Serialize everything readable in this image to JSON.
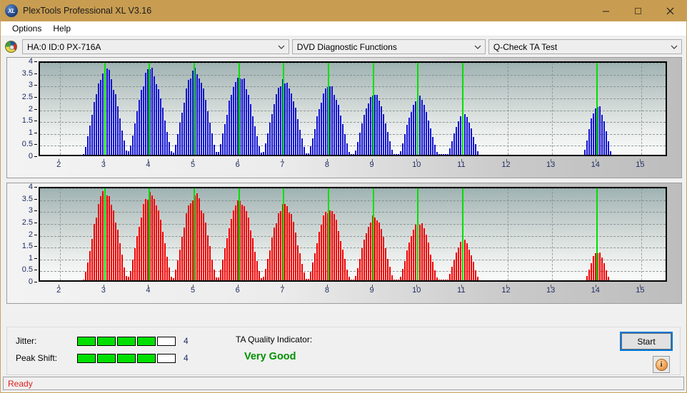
{
  "window": {
    "title": "PlexTools Professional XL V3.16",
    "app_icon": "xl-disc-icon",
    "minimize_label": "Minimize",
    "maximize_label": "Maximize",
    "close_label": "Close"
  },
  "menubar": {
    "items": [
      {
        "label": "Options"
      },
      {
        "label": "Help"
      }
    ]
  },
  "selectors": {
    "drive_icon": "optical-disc-icon",
    "drive": "HA:0 ID:0  PX-716A",
    "function": "DVD Diagnostic Functions",
    "test": "Q-Check TA Test"
  },
  "results": {
    "jitter_label": "Jitter:",
    "jitter_value": "4",
    "jitter_segments_on": 4,
    "jitter_segments_total": 5,
    "peak_shift_label": "Peak Shift:",
    "peak_shift_value": "4",
    "peak_shift_segments_on": 4,
    "peak_shift_segments_total": 5,
    "ta_title": "TA Quality Indicator:",
    "ta_value": "Very Good",
    "ta_color": "#009000",
    "meter_on_color": "#00e000",
    "start_label": "Start",
    "info_label": "i"
  },
  "statusbar": {
    "text": "Ready"
  },
  "chart_data": [
    {
      "type": "bar",
      "name": "jitter-chart",
      "title": "",
      "xlabel": "",
      "ylabel": "",
      "series_color": "#1414d2",
      "marker_color": "#00e000",
      "grid": true,
      "xlim": [
        1.55,
        15.6
      ],
      "ylim": [
        0,
        4
      ],
      "yticks": [
        0,
        0.5,
        1,
        1.5,
        2,
        2.5,
        3,
        3.5,
        4
      ],
      "ytick_labels": [
        "0",
        "0.5",
        "1",
        "1.5",
        "2",
        "2.5",
        "3",
        "3.5",
        "4"
      ],
      "xticks": [
        2,
        3,
        4,
        5,
        6,
        7,
        8,
        9,
        10,
        11,
        12,
        13,
        14,
        15
      ],
      "xtick_labels": [
        "2",
        "3",
        "4",
        "5",
        "6",
        "7",
        "8",
        "9",
        "10",
        "11",
        "12",
        "13",
        "14",
        "15"
      ],
      "markers": [
        3,
        4,
        5,
        6,
        7,
        8,
        9,
        10,
        11,
        14
      ],
      "lobes": [
        {
          "center": 3,
          "peak": 3.65,
          "half_width": 0.5,
          "valley": 1.45
        },
        {
          "center": 4,
          "peak": 3.62,
          "half_width": 0.5,
          "valley": 0.95
        },
        {
          "center": 5,
          "peak": 3.58,
          "half_width": 0.5,
          "valley": 1.15
        },
        {
          "center": 6,
          "peak": 3.38,
          "half_width": 0.5,
          "valley": 0.95
        },
        {
          "center": 7,
          "peak": 3.15,
          "half_width": 0.5,
          "valley": 0.6
        },
        {
          "center": 8,
          "peak": 2.92,
          "half_width": 0.48,
          "valley": 0.35
        },
        {
          "center": 9,
          "peak": 2.62,
          "half_width": 0.45,
          "valley": 0.18
        },
        {
          "center": 10,
          "peak": 2.45,
          "half_width": 0.44,
          "valley": 0.12
        },
        {
          "center": 11,
          "peak": 1.72,
          "half_width": 0.36,
          "valley": 0.05
        },
        {
          "center": 14,
          "peak": 2.15,
          "half_width": 0.32,
          "valley": 0.0
        }
      ]
    },
    {
      "type": "bar",
      "name": "peak-shift-chart",
      "title": "",
      "xlabel": "",
      "ylabel": "",
      "series_color": "#f20000",
      "marker_color": "#00e000",
      "grid": true,
      "xlim": [
        1.55,
        15.6
      ],
      "ylim": [
        0,
        4
      ],
      "yticks": [
        0,
        0.5,
        1,
        1.5,
        2,
        2.5,
        3,
        3.5,
        4
      ],
      "ytick_labels": [
        "0",
        "0.5",
        "1",
        "1.5",
        "2",
        "2.5",
        "3",
        "3.5",
        "4"
      ],
      "xticks": [
        2,
        3,
        4,
        5,
        6,
        7,
        8,
        9,
        10,
        11,
        12,
        13,
        14,
        15
      ],
      "xtick_labels": [
        "2",
        "3",
        "4",
        "5",
        "6",
        "7",
        "8",
        "9",
        "10",
        "11",
        "12",
        "13",
        "14",
        "15"
      ],
      "markers": [
        3,
        4,
        5,
        6,
        7,
        8,
        9,
        10,
        11,
        14
      ],
      "lobes": [
        {
          "center": 3,
          "peak": 3.75,
          "half_width": 0.5,
          "valley": 1.45
        },
        {
          "center": 4,
          "peak": 3.72,
          "half_width": 0.5,
          "valley": 0.8
        },
        {
          "center": 5,
          "peak": 3.62,
          "half_width": 0.5,
          "valley": 1.1
        },
        {
          "center": 6,
          "peak": 3.45,
          "half_width": 0.5,
          "valley": 0.9
        },
        {
          "center": 7,
          "peak": 3.22,
          "half_width": 0.5,
          "valley": 0.55
        },
        {
          "center": 8,
          "peak": 3.0,
          "half_width": 0.48,
          "valley": 0.3
        },
        {
          "center": 9,
          "peak": 2.7,
          "half_width": 0.45,
          "valley": 0.15
        },
        {
          "center": 10,
          "peak": 2.45,
          "half_width": 0.44,
          "valley": 0.1
        },
        {
          "center": 11,
          "peak": 1.72,
          "half_width": 0.36,
          "valley": 0.04
        },
        {
          "center": 14,
          "peak": 1.22,
          "half_width": 0.28,
          "valley": 0.0
        }
      ]
    }
  ]
}
